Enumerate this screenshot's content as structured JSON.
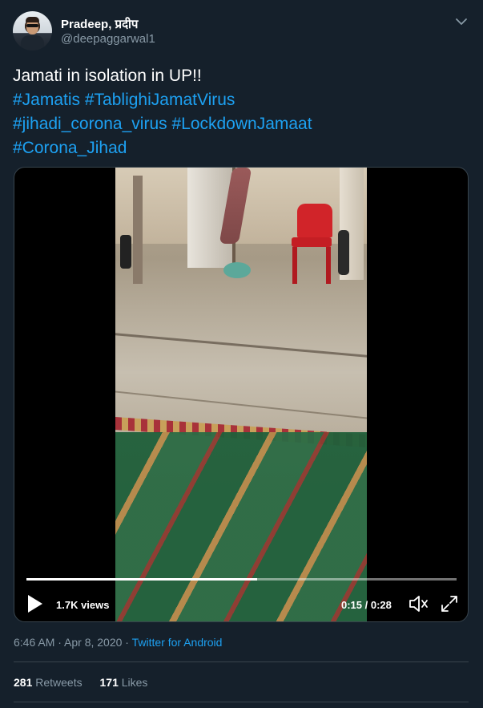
{
  "author": {
    "display_name": "Pradeep, प्रदीप",
    "handle": "@deepaggarwal1"
  },
  "tweet": {
    "text_line1": "Jamati in isolation in UP!!",
    "hashtags": [
      "#Jamatis",
      "#TablighiJamatVirus",
      "#jihadi_corona_virus",
      "#LockdownJamaat",
      "#Corona_Jihad"
    ]
  },
  "video": {
    "views": "1.7K views",
    "time": "0:15 / 0:28",
    "progress": 0.536
  },
  "meta": {
    "timestamp": "6:46 AM · Apr 8, 2020",
    "separator": " · ",
    "client": "Twitter for Android"
  },
  "stats": {
    "retweets_count": "281",
    "retweets_label": "Retweets",
    "likes_count": "171",
    "likes_label": "Likes"
  },
  "icons": {
    "caret": "chevron-down-icon",
    "play": "play-icon",
    "volume": "volume-icon",
    "fullscreen": "fullscreen-icon"
  },
  "colors": {
    "background": "#15202b",
    "link": "#1da1f2",
    "muted": "#8899a6",
    "border": "#38444d"
  }
}
